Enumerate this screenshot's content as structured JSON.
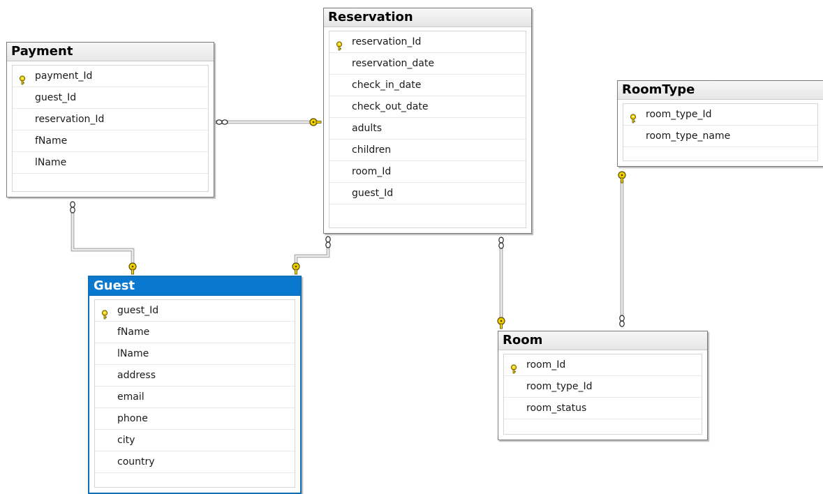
{
  "colors": {
    "connector": "#7f7f7f",
    "key": "#f2d200",
    "selected_header": "#0b78d0"
  },
  "tables": [
    {
      "id": "payment",
      "title": "Payment",
      "selected": false,
      "columns": [
        {
          "name": "payment_Id",
          "primary_key": true
        },
        {
          "name": "guest_Id",
          "primary_key": false
        },
        {
          "name": "reservation_Id",
          "primary_key": false
        },
        {
          "name": "fName",
          "primary_key": false
        },
        {
          "name": "lName",
          "primary_key": false
        }
      ]
    },
    {
      "id": "reservation",
      "title": "Reservation",
      "selected": false,
      "columns": [
        {
          "name": "reservation_Id",
          "primary_key": true
        },
        {
          "name": "reservation_date",
          "primary_key": false
        },
        {
          "name": "check_in_date",
          "primary_key": false
        },
        {
          "name": "check_out_date",
          "primary_key": false
        },
        {
          "name": "adults",
          "primary_key": false
        },
        {
          "name": "children",
          "primary_key": false
        },
        {
          "name": "room_Id",
          "primary_key": false
        },
        {
          "name": "guest_Id",
          "primary_key": false
        }
      ]
    },
    {
      "id": "roomtype",
      "title": "RoomType",
      "selected": false,
      "columns": [
        {
          "name": "room_type_Id",
          "primary_key": true
        },
        {
          "name": "room_type_name",
          "primary_key": false
        }
      ]
    },
    {
      "id": "guest",
      "title": "Guest",
      "selected": true,
      "columns": [
        {
          "name": "guest_Id",
          "primary_key": true
        },
        {
          "name": "fName",
          "primary_key": false
        },
        {
          "name": "lName",
          "primary_key": false
        },
        {
          "name": "address",
          "primary_key": false
        },
        {
          "name": "email",
          "primary_key": false
        },
        {
          "name": "phone",
          "primary_key": false
        },
        {
          "name": "city",
          "primary_key": false
        },
        {
          "name": "country",
          "primary_key": false
        }
      ]
    },
    {
      "id": "room",
      "title": "Room",
      "selected": false,
      "columns": [
        {
          "name": "room_Id",
          "primary_key": true
        },
        {
          "name": "room_type_Id",
          "primary_key": false
        },
        {
          "name": "room_status",
          "primary_key": false
        }
      ]
    }
  ],
  "relationships": [
    {
      "id": "payment-reservation",
      "many": "payment",
      "one": "reservation"
    },
    {
      "id": "payment-guest",
      "many": "payment",
      "one": "guest"
    },
    {
      "id": "reservation-guest",
      "many": "reservation",
      "one": "guest"
    },
    {
      "id": "reservation-room",
      "many": "reservation",
      "one": "room"
    },
    {
      "id": "room-roomtype",
      "many": "room",
      "one": "roomtype"
    }
  ]
}
